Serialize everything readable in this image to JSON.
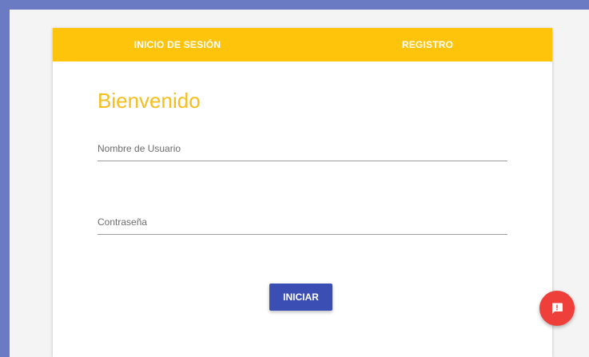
{
  "tabs": {
    "login_label": "INICIO DE SESIÓN",
    "register_label": "REGISTRO"
  },
  "title": "Bienvenido",
  "form": {
    "username_placeholder": "Nombre de Usuario",
    "username_value": "",
    "password_placeholder": "Contraseña",
    "password_value": "",
    "submit_label": "INICIAR"
  },
  "fab": {
    "icon": "feedback-icon"
  },
  "colors": {
    "frame": "#6a7bc3",
    "tab_bar": "#fec40c",
    "title": "#f6be1c",
    "submit": "#3b4eb3",
    "fab": "#ef3f3a"
  }
}
